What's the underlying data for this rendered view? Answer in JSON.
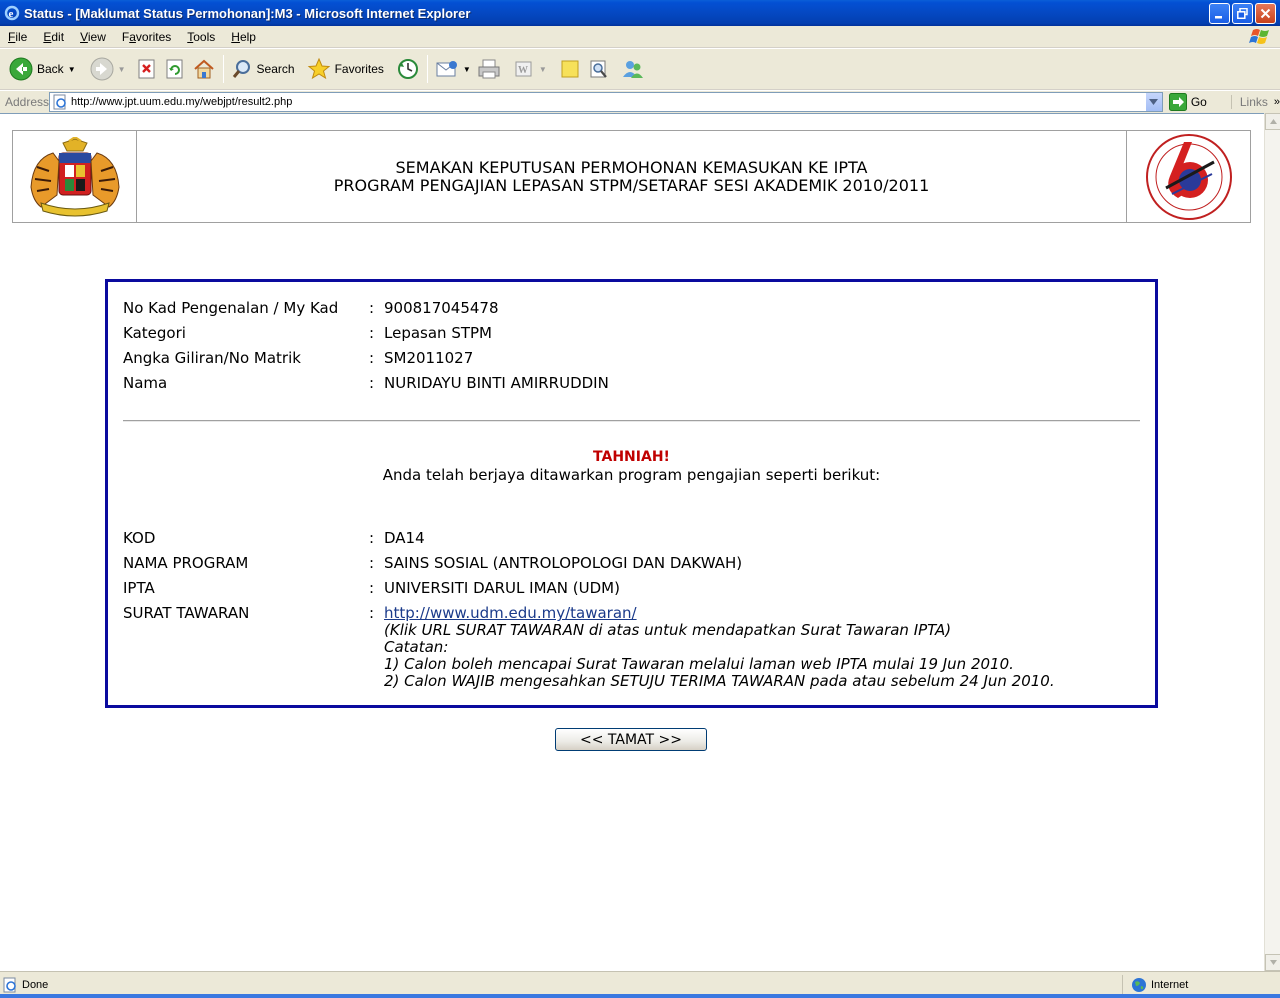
{
  "window": {
    "title": "Status - [Maklumat Status Permohonan]:M3 - Microsoft Internet Explorer"
  },
  "menu": {
    "items": [
      {
        "accel": "F",
        "rest": "ile"
      },
      {
        "accel": "E",
        "rest": "dit"
      },
      {
        "accel": "V",
        "rest": "iew"
      },
      {
        "pre": "F",
        "accel": "a",
        "rest": "vorites"
      },
      {
        "accel": "T",
        "rest": "ools"
      },
      {
        "accel": "H",
        "rest": "elp"
      }
    ]
  },
  "toolbar": {
    "back_label": "Back",
    "search_label": "Search",
    "favorites_label": "Favorites"
  },
  "addressbar": {
    "label": "Address",
    "url": "http://www.jpt.uum.edu.my/webjpt/result2.php",
    "go_label": "Go",
    "links_label": "Links"
  },
  "page": {
    "header": {
      "line1": "SEMAKAN KEPUTUSAN PERMOHONAN KEMASUKAN KE IPTA",
      "line2": "PROGRAM PENGAJIAN LEPASAN STPM/SETARAF SESI AKADEMIK 2010/2011"
    },
    "applicant": [
      {
        "label": "No Kad Pengenalan / My Kad",
        "value": "900817045478"
      },
      {
        "label": "Kategori",
        "value": "Lepasan STPM"
      },
      {
        "label": "Angka Giliran/No Matrik",
        "value": "SM2011027"
      },
      {
        "label": "Nama",
        "value": "NURIDAYU BINTI AMIRRUDDIN"
      }
    ],
    "congrats": "TAHNIAH!",
    "offered_text": "Anda telah berjaya ditawarkan program pengajian seperti berikut:",
    "program": [
      {
        "label": "KOD",
        "value": "DA14"
      },
      {
        "label": "NAMA PROGRAM",
        "value": "SAINS SOSIAL (ANTROLOPOLOGI DAN DAKWAH)"
      },
      {
        "label": "IPTA",
        "value": "UNIVERSITI DARUL IMAN (UDM)"
      },
      {
        "label": "SURAT TAWARAN",
        "value": "http://www.udm.edu.my/tawaran/"
      }
    ],
    "notes": [
      "(Klik URL SURAT TAWARAN di atas untuk mendapatkan Surat Tawaran IPTA)",
      "Catatan:",
      "1) Calon boleh mencapai Surat Tawaran melalui laman web IPTA mulai 19 Jun 2010.",
      "2) Calon WAJIB mengesahkan SETUJU TERIMA TAWARAN pada atau sebelum 24 Jun 2010."
    ],
    "colon": ":",
    "finish_button": "<< TAMAT >>"
  },
  "status": {
    "left": "Done",
    "zone": "Internet"
  }
}
